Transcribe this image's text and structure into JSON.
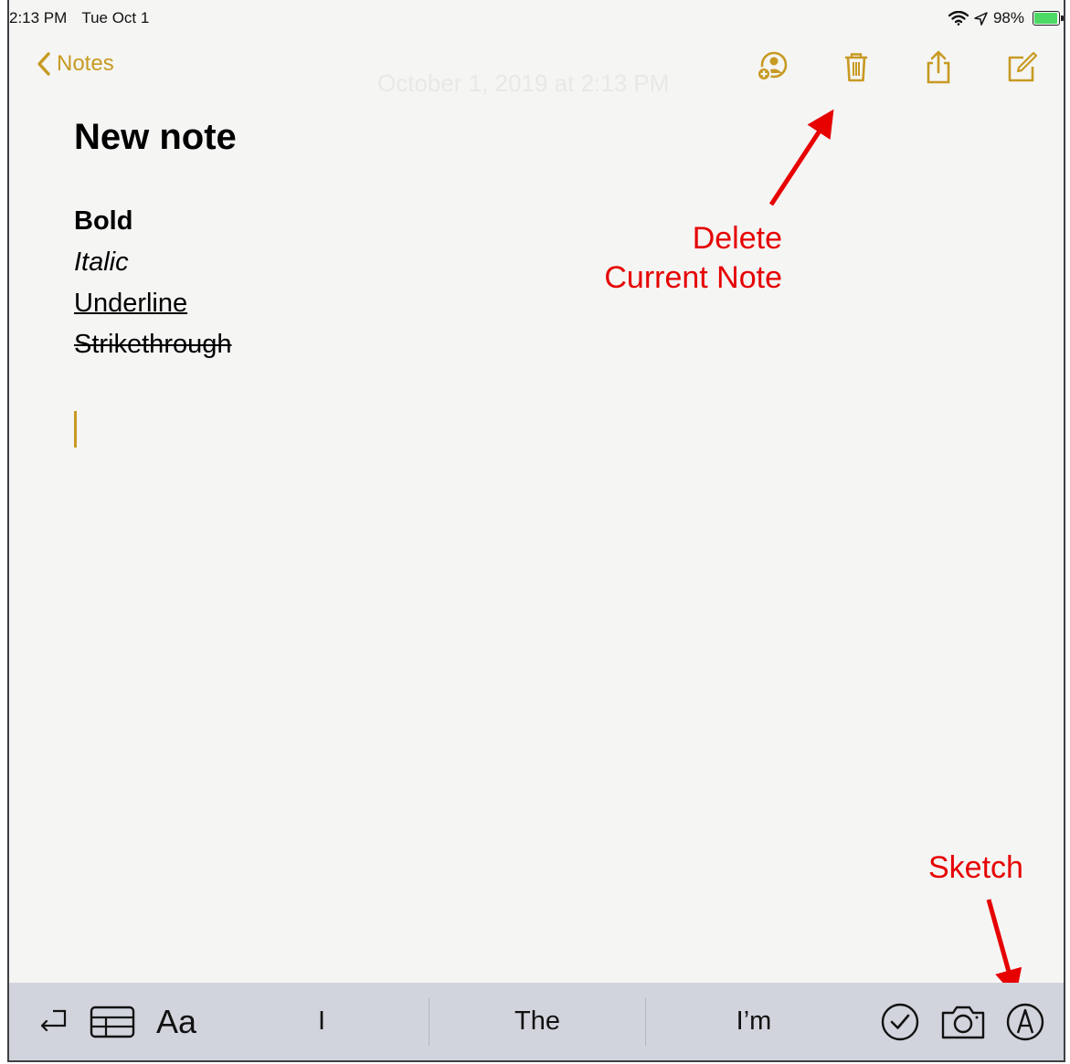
{
  "status_bar": {
    "time": "2:13 PM",
    "date": "Tue Oct 1",
    "battery": "98%",
    "battery_level": 0.98
  },
  "nav": {
    "back_label": "Notes",
    "date_watermark": "October 1, 2019 at 2:13 PM",
    "icons": [
      "add-person-icon",
      "trash-icon",
      "share-icon",
      "compose-icon"
    ]
  },
  "note": {
    "title": "New note",
    "lines": {
      "bold": "Bold",
      "italic": "Italic",
      "underline": "Underline",
      "strikethrough": "Strikethrough"
    }
  },
  "annotations": {
    "delete_line1": "Delete",
    "delete_line2": "Current Note",
    "sketch": "Sketch",
    "color": "#e60000"
  },
  "bottom_bar": {
    "suggestions": [
      "I",
      "The",
      "I’m"
    ],
    "format_label": "Aa",
    "icons": [
      "undo-icon",
      "table-icon",
      "format-icon",
      "checklist-icon",
      "camera-icon",
      "sketch-icon"
    ]
  },
  "accent_color": "#c79a22"
}
